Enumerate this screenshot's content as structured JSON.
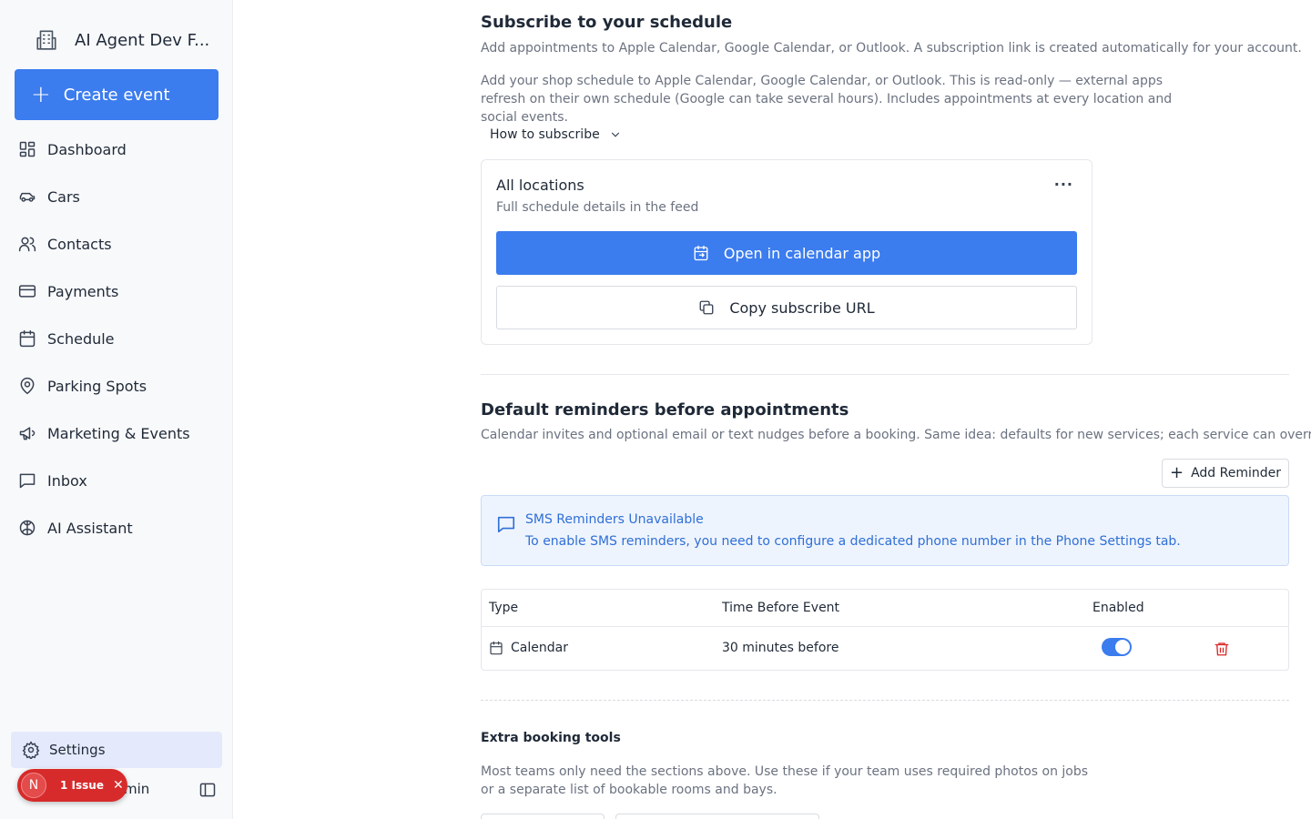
{
  "sidebar": {
    "org_name": "AI Agent Dev F...",
    "create_label": "Create event",
    "items": [
      {
        "label": "Dashboard"
      },
      {
        "label": "Cars"
      },
      {
        "label": "Contacts"
      },
      {
        "label": "Payments"
      },
      {
        "label": "Schedule"
      },
      {
        "label": "Parking Spots"
      },
      {
        "label": "Marketing & Events"
      },
      {
        "label": "Inbox"
      },
      {
        "label": "AI Assistant"
      }
    ],
    "settings_label": "Settings",
    "user_text": "min",
    "issue_avatar": "N",
    "issue_text": "1 Issue",
    "issue_close": "✕"
  },
  "subscribe": {
    "title": "Subscribe to your schedule",
    "subtitle": "Add appointments to Apple Calendar, Google Calendar, or Outlook. A subscription link is created automatically for your account.",
    "description": "Add your shop schedule to Apple Calendar, Google Calendar, or Outlook. This is read-only — external apps refresh on their own schedule (Google can take several hours). Includes appointments at every location and social events.",
    "how_label": "How to subscribe",
    "card": {
      "title": "All locations",
      "subtitle": "Full schedule details in the feed",
      "menu": "···",
      "open_label": "Open in calendar app",
      "copy_label": "Copy subscribe URL"
    }
  },
  "reminders": {
    "title": "Default reminders before appointments",
    "subtitle": "Calendar invites and optional email or text nudges before a booking. Same idea: defaults for new services; each service can override.",
    "add_label": "Add Reminder",
    "alert": {
      "title": "SMS Reminders Unavailable",
      "description": "To enable SMS reminders, you need to configure a dedicated phone number in the Phone Settings tab."
    },
    "table": {
      "headers": {
        "type": "Type",
        "time": "Time Before Event",
        "enabled": "Enabled"
      },
      "rows": [
        {
          "type": "Calendar",
          "time": "30 minutes before",
          "enabled": true
        }
      ]
    }
  },
  "extra": {
    "title": "Extra booking tools",
    "description": "Most teams only need the sections above. Use these if your team uses required photos on jobs or a separate list of bookable rooms and bays."
  },
  "colors": {
    "accent": "#3b7cee",
    "danger": "#dc2626",
    "alert_text": "#2f6fd6"
  }
}
